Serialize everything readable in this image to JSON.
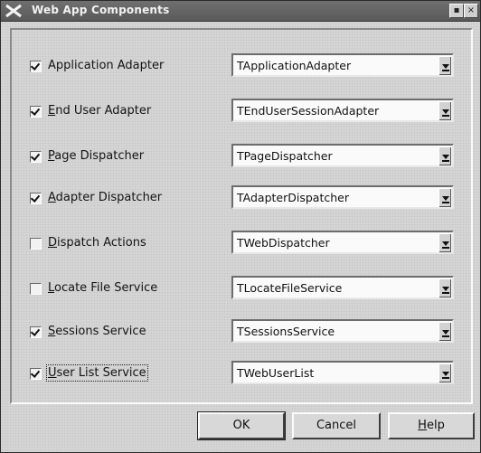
{
  "window": {
    "title": "Web App Components",
    "buttons": {
      "minimize": "▪",
      "close": "×"
    }
  },
  "rows": [
    {
      "checked": true,
      "label": "Application Adapter",
      "accel_index": -1,
      "combo_value": "TApplicationAdapter"
    },
    {
      "checked": true,
      "label": "End User Adapter",
      "accel_index": 0,
      "combo_value": "TEndUserSessionAdapter"
    },
    {
      "checked": true,
      "label": "Page Dispatcher",
      "accel_index": 0,
      "combo_value": "TPageDispatcher"
    },
    {
      "checked": true,
      "label": "Adapter Dispatcher",
      "accel_index": 0,
      "combo_value": "TAdapterDispatcher"
    },
    {
      "checked": false,
      "label": "Dispatch Actions",
      "accel_index": 0,
      "combo_value": "TWebDispatcher"
    },
    {
      "checked": false,
      "label": "Locate File Service",
      "accel_index": 0,
      "combo_value": "TLocateFileService"
    },
    {
      "checked": true,
      "label": "Sessions Service",
      "accel_index": 0,
      "combo_value": "TSessionsService"
    },
    {
      "checked": true,
      "label": "User List Service",
      "accel_index": 0,
      "combo_value": "TWebUserList"
    }
  ],
  "focused_row": 7,
  "footer": {
    "ok_label": "OK",
    "cancel_label": "Cancel",
    "help_label": "Help"
  }
}
